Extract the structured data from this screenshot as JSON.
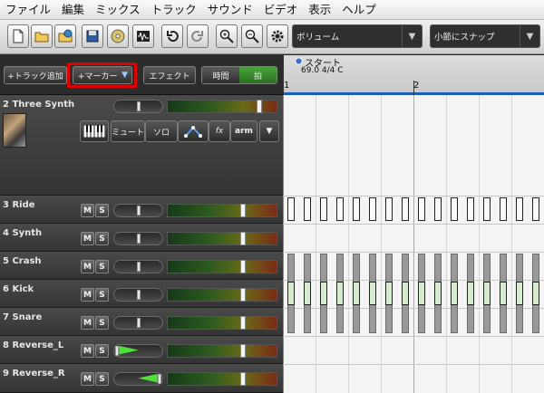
{
  "menu": [
    "ファイル",
    "編集",
    "ミックス",
    "トラック",
    "サウンド",
    "ビデオ",
    "表示",
    "ヘルプ"
  ],
  "toolbar": {
    "volume_label": "ボリューム",
    "snap_label": "小節にスナップ"
  },
  "header": {
    "add_track": "+トラック追加",
    "add_marker": "+マーカー",
    "effect": "エフェクト",
    "time_label": "時間",
    "beat_label": "拍"
  },
  "synth": {
    "mute": "ミュート",
    "solo": "ソロ",
    "fx": "fx",
    "arm": "arm"
  },
  "ms_labels": {
    "m": "M",
    "s": "S"
  },
  "tracks": [
    {
      "name": "2 Three Synth",
      "pan": 0.5,
      "volume": 0.83
    },
    {
      "name": "3 Ride",
      "pan": 0.5,
      "volume": 0.83
    },
    {
      "name": "4 Synth",
      "pan": 0.5,
      "volume": 0.83
    },
    {
      "name": "5 Crash",
      "pan": 0.5,
      "volume": 0.83
    },
    {
      "name": "6 Kick",
      "pan": 0.5,
      "volume": 0.83
    },
    {
      "name": "7 Snare",
      "pan": 0.5,
      "volume": 0.83
    },
    {
      "name": "8 Reverse_L",
      "pan": 0.0,
      "volume": 0.83
    },
    {
      "name": "9 Reverse_R",
      "pan": 1.0,
      "volume": 0.83
    }
  ],
  "ruler": {
    "marker_name": "スタート",
    "tempo": "69.0 4/4 C",
    "bar1": "1",
    "bar2": "2"
  },
  "colors": {
    "accent_blue": "#1a5fbd",
    "highlight_red": "#e00000",
    "beat_green": "#2f7d25"
  }
}
